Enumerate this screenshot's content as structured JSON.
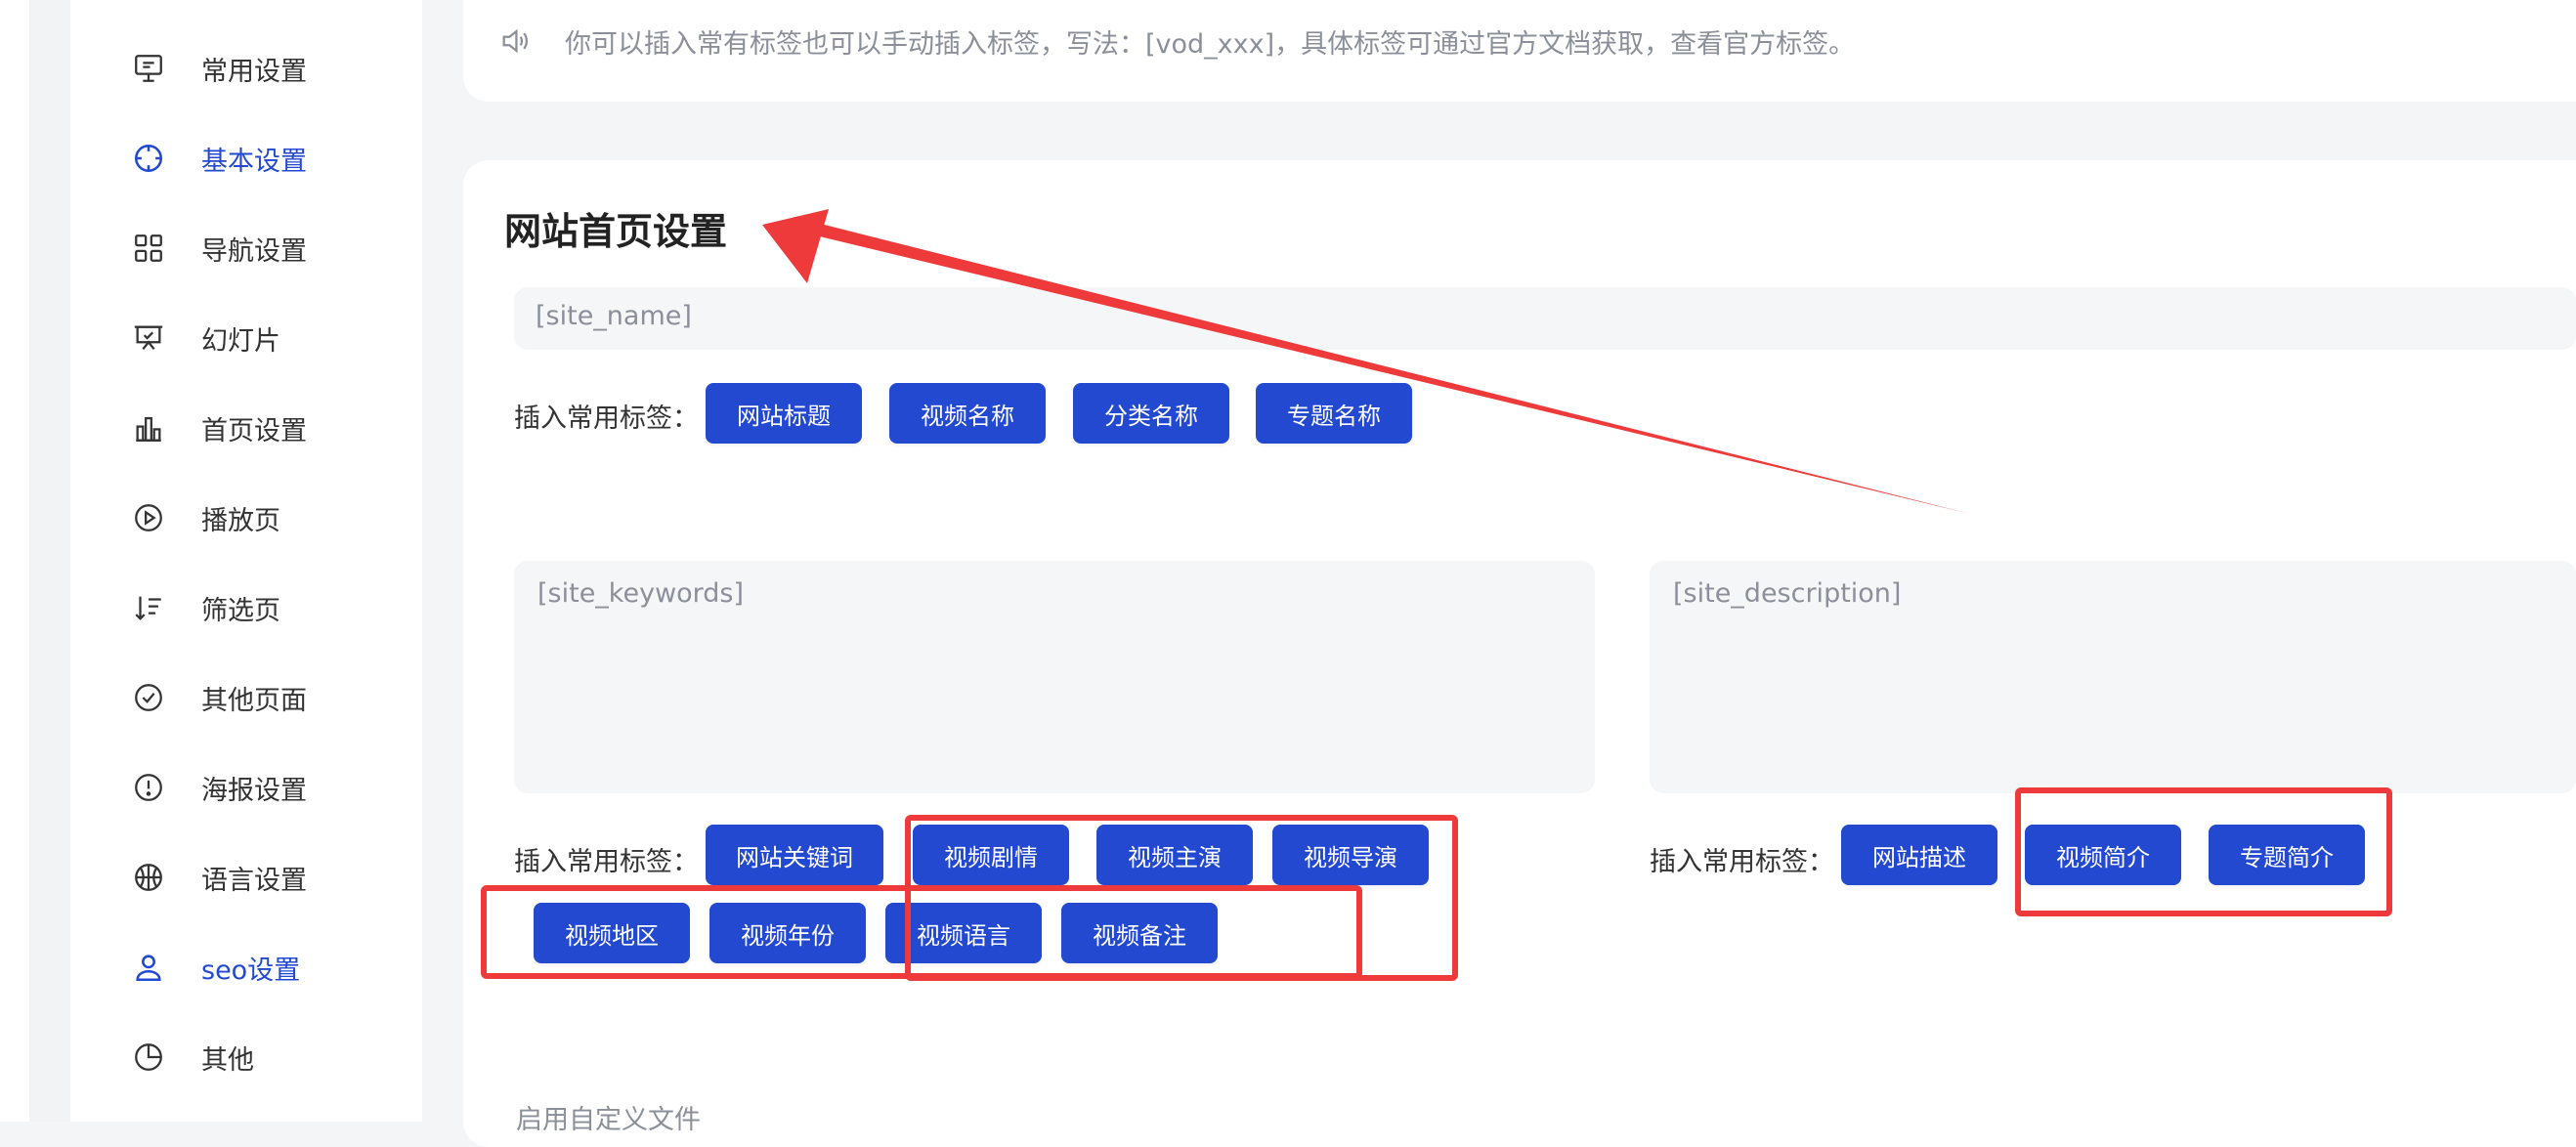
{
  "colors": {
    "accent": "#2249d0",
    "annotation": "#ee3a3a"
  },
  "sidebar": {
    "items": [
      {
        "label": "常用设置",
        "icon": "monitor-settings-icon",
        "active": false
      },
      {
        "label": "基本设置",
        "icon": "target-crosshair-icon",
        "active": true
      },
      {
        "label": "导航设置",
        "icon": "grid-icon",
        "active": false
      },
      {
        "label": "幻灯片",
        "icon": "presentation-icon",
        "active": false
      },
      {
        "label": "首页设置",
        "icon": "bar-chart-icon",
        "active": false
      },
      {
        "label": "播放页",
        "icon": "play-circle-icon",
        "active": false
      },
      {
        "label": "筛选页",
        "icon": "sort-filter-icon",
        "active": false
      },
      {
        "label": "其他页面",
        "icon": "check-circle-icon",
        "active": false
      },
      {
        "label": "海报设置",
        "icon": "alert-circle-icon",
        "active": false
      },
      {
        "label": "语言设置",
        "icon": "globe-ball-icon",
        "active": false
      },
      {
        "label": "seo设置",
        "icon": "user-icon",
        "active": true
      },
      {
        "label": "其他",
        "icon": "pie-chart-icon",
        "active": false
      }
    ]
  },
  "notice": {
    "icon": "speaker-icon",
    "text": "你可以插入常有标签也可以手动插入标签，写法：[vod_xxx]，具体标签可通过官方文档获取，查看官方标签。"
  },
  "homepage_section": {
    "title": "网站首页设置",
    "site_name_placeholder": "[site_name]",
    "insert_label": "插入常用标签：",
    "name_tags": [
      "网站标题",
      "视频名称",
      "分类名称",
      "专题名称"
    ],
    "keywords_placeholder": "[site_keywords]",
    "keywords_insert_label": "插入常用标签：",
    "keyword_tags": [
      "网站关键词",
      "视频剧情",
      "视频主演",
      "视频导演",
      "视频地区",
      "视频年份",
      "视频语言",
      "视频备注"
    ],
    "description_placeholder": "[site_description]",
    "description_insert_label": "插入常用标签：",
    "description_tags": [
      "网站描述",
      "视频简介",
      "专题简介"
    ]
  },
  "footer_label": "启用自定义文件"
}
